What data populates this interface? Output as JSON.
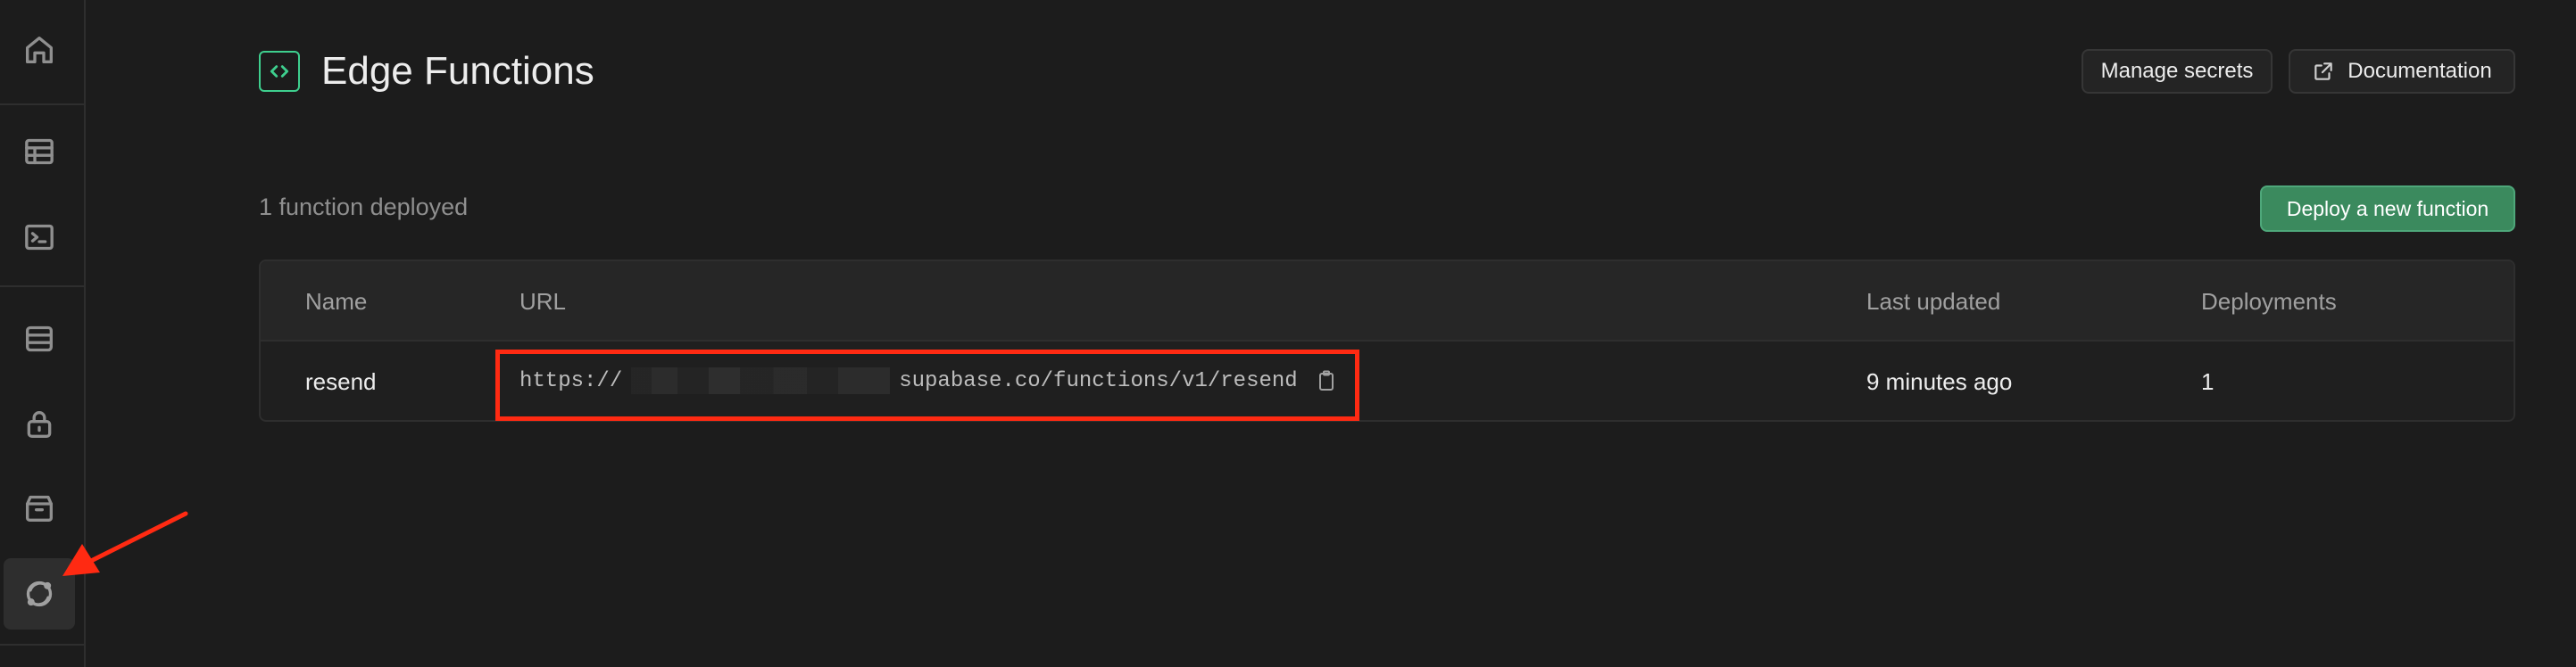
{
  "sidebar": {
    "items": [
      {
        "icon": "home-icon",
        "name": "home"
      },
      {
        "icon": "table-icon",
        "name": "table-editor"
      },
      {
        "icon": "terminal-icon",
        "name": "sql-editor"
      },
      {
        "icon": "database-icon",
        "name": "database"
      },
      {
        "icon": "lock-icon",
        "name": "authentication"
      },
      {
        "icon": "storage-icon",
        "name": "storage"
      },
      {
        "icon": "edge-functions-icon",
        "name": "edge-functions",
        "active": true
      }
    ]
  },
  "header": {
    "title": "Edge Functions",
    "manage_secrets_label": "Manage secrets",
    "documentation_label": "Documentation"
  },
  "summary": {
    "deployed_text": "1 function deployed",
    "deploy_button_label": "Deploy a new function"
  },
  "table": {
    "columns": [
      "Name",
      "URL",
      "Last updated",
      "Deployments"
    ],
    "rows": [
      {
        "name": "resend",
        "url_prefix": "https://",
        "url_suffix": "supabase.co/functions/v1/resend",
        "last_updated": "9 minutes ago",
        "deployments": "1"
      }
    ]
  },
  "colors": {
    "accent": "#3ecf8e",
    "deploy_button": "#3b8a5e",
    "annotation": "#ff2a12",
    "background": "#1c1c1c"
  }
}
